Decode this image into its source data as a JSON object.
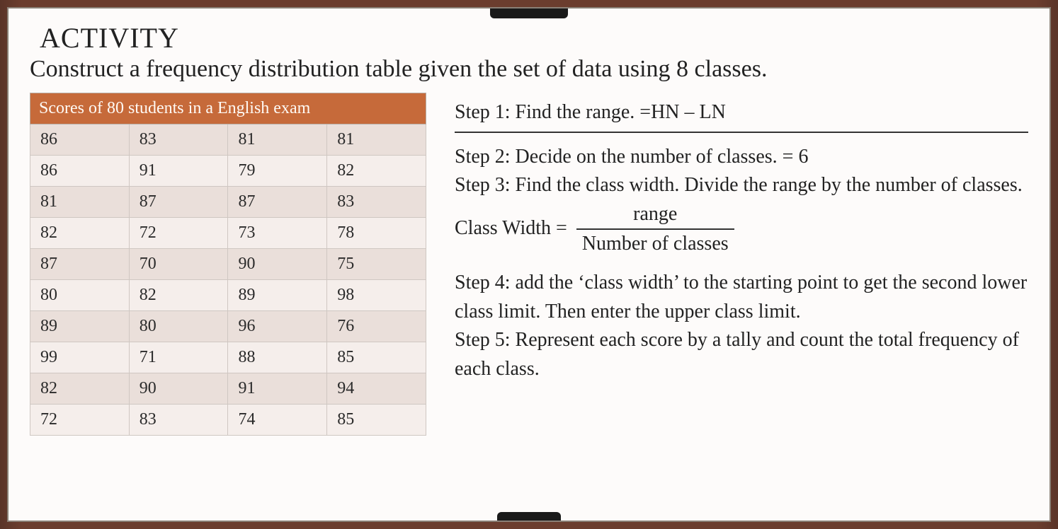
{
  "heading": "ACTIVITY",
  "subheading": "Construct a frequency distribution table given the set of data using 8 classes.",
  "table": {
    "title": "Scores of  80 students in a English exam",
    "rows": [
      [
        "86",
        "83",
        "81",
        "81"
      ],
      [
        "86",
        "91",
        "79",
        "82"
      ],
      [
        "81",
        "87",
        "87",
        "83"
      ],
      [
        "82",
        "72",
        "73",
        "78"
      ],
      [
        "87",
        "70",
        "90",
        "75"
      ],
      [
        "80",
        "82",
        "89",
        "98"
      ],
      [
        "89",
        "80",
        "96",
        "76"
      ],
      [
        "99",
        "71",
        "88",
        "85"
      ],
      [
        "82",
        "90",
        "91",
        "94"
      ],
      [
        "72",
        "83",
        "74",
        "85"
      ]
    ]
  },
  "steps": {
    "s1": "Step 1: Find the range. =HN – LN",
    "s2": "Step 2: Decide on the number of classes. = 6",
    "s3": "Step 3: Find the class width. Divide the range by the number of classes.",
    "cw_label": "Class Width =",
    "cw_num": "range",
    "cw_den": "Number of classes",
    "s4": "Step 4: add the ‘class width’ to the starting point to get the second lower class limit. Then enter the upper class limit.",
    "s5": "Step 5: Represent each score by a tally and count the total frequency of each class."
  }
}
